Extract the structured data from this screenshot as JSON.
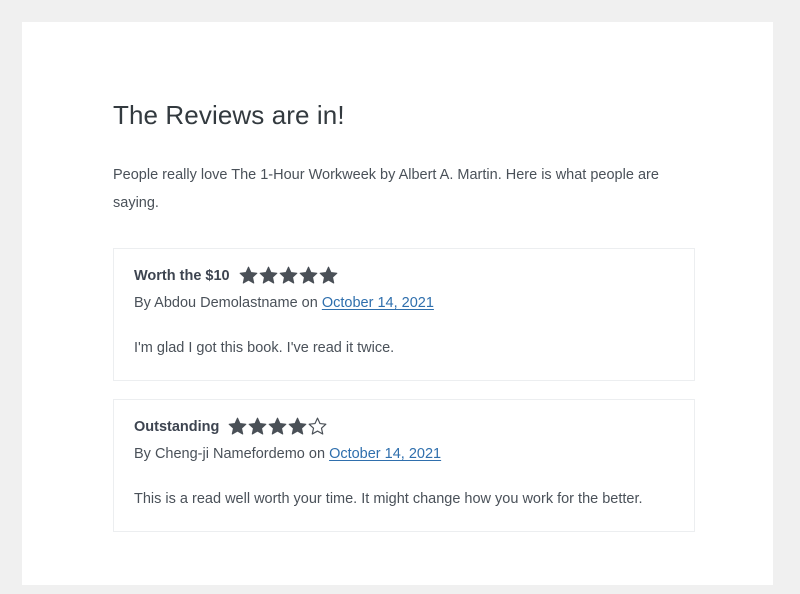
{
  "theme": {
    "page_background": "#f0f0f0",
    "panel_background": "#ffffff",
    "card_border": "#eceef0",
    "heading_color": "#333a3f",
    "body_text_color": "#4a5159",
    "review_title_color": "#3d4450",
    "link_color": "#2f6fad",
    "star_color": "#4a5057"
  },
  "page": {
    "title": "The Reviews are in!",
    "intro": "People really love The 1-Hour Workweek by Albert A. Martin. Here is what people are saying."
  },
  "reviews": [
    {
      "title": "Worth the $10",
      "rating": 5,
      "max_rating": 5,
      "byline_prefix": "By",
      "author": "Abdou Demolastname",
      "byline_connector": "on",
      "date": "October 14, 2021",
      "body": "I'm glad I got this book. I've read it twice."
    },
    {
      "title": "Outstanding",
      "rating": 4,
      "max_rating": 5,
      "byline_prefix": "By",
      "author": "Cheng-ji Namefordemo",
      "byline_connector": "on",
      "date": "October 14, 2021",
      "body": "This is a read well worth your time. It might change how you work for the better."
    }
  ]
}
